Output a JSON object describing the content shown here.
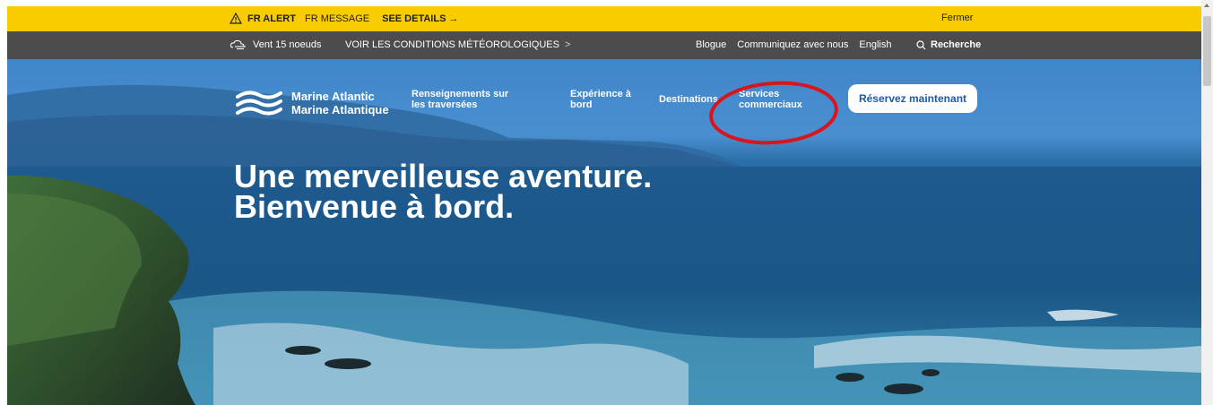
{
  "alert": {
    "label": "FR ALERT",
    "message": "FR MESSAGE",
    "details": "SEE DETAILS",
    "details_arrow": "→",
    "close": "Fermer"
  },
  "utility": {
    "wind": "Vent 15 noeuds",
    "weather_link": "VOIR LES CONDITIONS MÉTÉOROLOGIQUES",
    "weather_chevron": ">",
    "links": [
      "Blogue",
      "Communiquez avec nous",
      "English"
    ],
    "search": "Recherche"
  },
  "logo": {
    "line1": "Marine Atlantic",
    "line2": "Marine Atlantique"
  },
  "nav": [
    {
      "label": "Renseignements sur les traversées"
    },
    {
      "label": "Expérience à bord"
    },
    {
      "label": "Destinations"
    },
    {
      "label": "Services commerciaux"
    }
  ],
  "cta": {
    "label": "Réservez maintenant"
  },
  "hero": {
    "line1": "Une merveilleuse aventure.",
    "line2": "Bienvenue à bord."
  },
  "icons": [
    "warning-icon",
    "cloud-wind-icon",
    "search-icon",
    "wave-logo-icon"
  ],
  "colors": {
    "alert_bg": "#f9cc00",
    "utility_bg": "#4c4c4c",
    "cta_text": "#1f5aa6",
    "annotation": "#d9141c"
  }
}
